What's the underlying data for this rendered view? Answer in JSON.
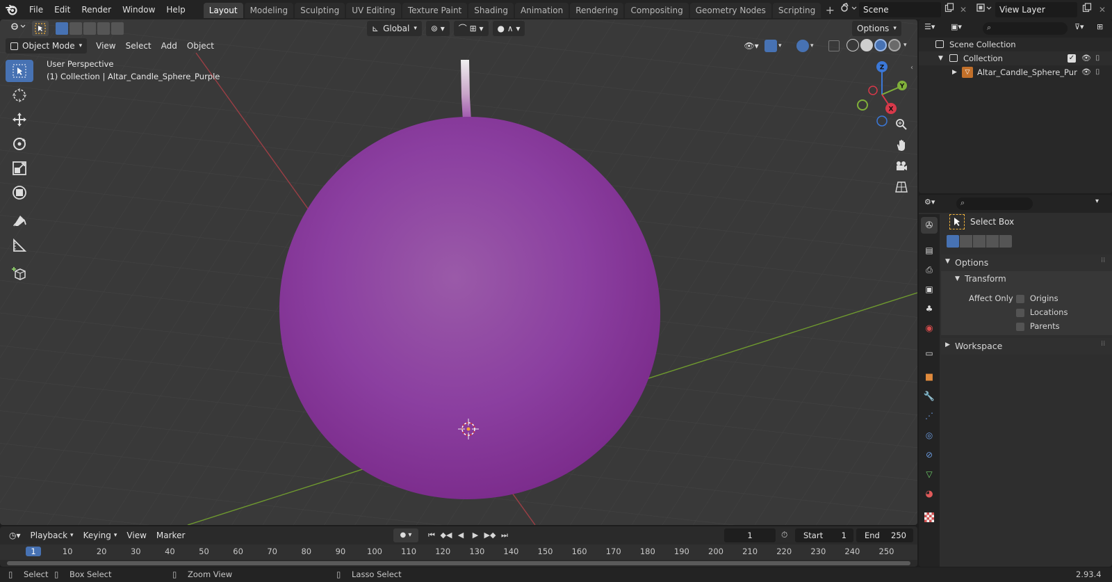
{
  "topbar": {
    "menus": [
      "File",
      "Edit",
      "Render",
      "Window",
      "Help"
    ],
    "workspaces": [
      "Layout",
      "Modeling",
      "Sculpting",
      "UV Editing",
      "Texture Paint",
      "Shading",
      "Animation",
      "Rendering",
      "Compositing",
      "Geometry Nodes",
      "Scripting"
    ],
    "active_workspace": "Layout",
    "add_tab": "+",
    "scene": "Scene",
    "view_layer": "View Layer"
  },
  "viewport": {
    "transform_orientation": "Global",
    "options_label": "Options",
    "mode": "Object Mode",
    "menus": [
      "View",
      "Select",
      "Add",
      "Object"
    ],
    "perspective_label": "User Perspective",
    "collection_label": "(1) Collection | Altar_Candle_Sphere_Purple",
    "gizmo_axes": [
      "Z",
      "Y",
      "X"
    ],
    "colors": {
      "background": "#393939",
      "sphere": "#8b3fa0",
      "x_axis": "#9b3f45",
      "y_axis": "#6f9a2f",
      "active_tool": "#4772b3"
    }
  },
  "outliner": {
    "scene_collection": "Scene Collection",
    "collection": "Collection",
    "object": "Altar_Candle_Sphere_Pur"
  },
  "properties": {
    "tool_name": "Select Box",
    "options_panel": "Options",
    "transform_panel": "Transform",
    "affect_only_label": "Affect Only",
    "checkboxes": [
      "Origins",
      "Locations",
      "Parents"
    ],
    "workspace_panel": "Workspace"
  },
  "timeline": {
    "menus": [
      "Playback",
      "Keying",
      "View",
      "Marker"
    ],
    "current_frame": "1",
    "start_label": "Start",
    "start_value": "1",
    "end_label": "End",
    "end_value": "250",
    "ruler": [
      "1",
      "10",
      "20",
      "30",
      "40",
      "50",
      "60",
      "70",
      "80",
      "90",
      "100",
      "110",
      "120",
      "130",
      "140",
      "150",
      "160",
      "170",
      "180",
      "190",
      "200",
      "210",
      "220",
      "230",
      "240",
      "250"
    ]
  },
  "statusbar": {
    "select": "Select",
    "box_select": "Box Select",
    "zoom_view": "Zoom View",
    "lasso_select": "Lasso Select",
    "version": "2.93.4"
  }
}
